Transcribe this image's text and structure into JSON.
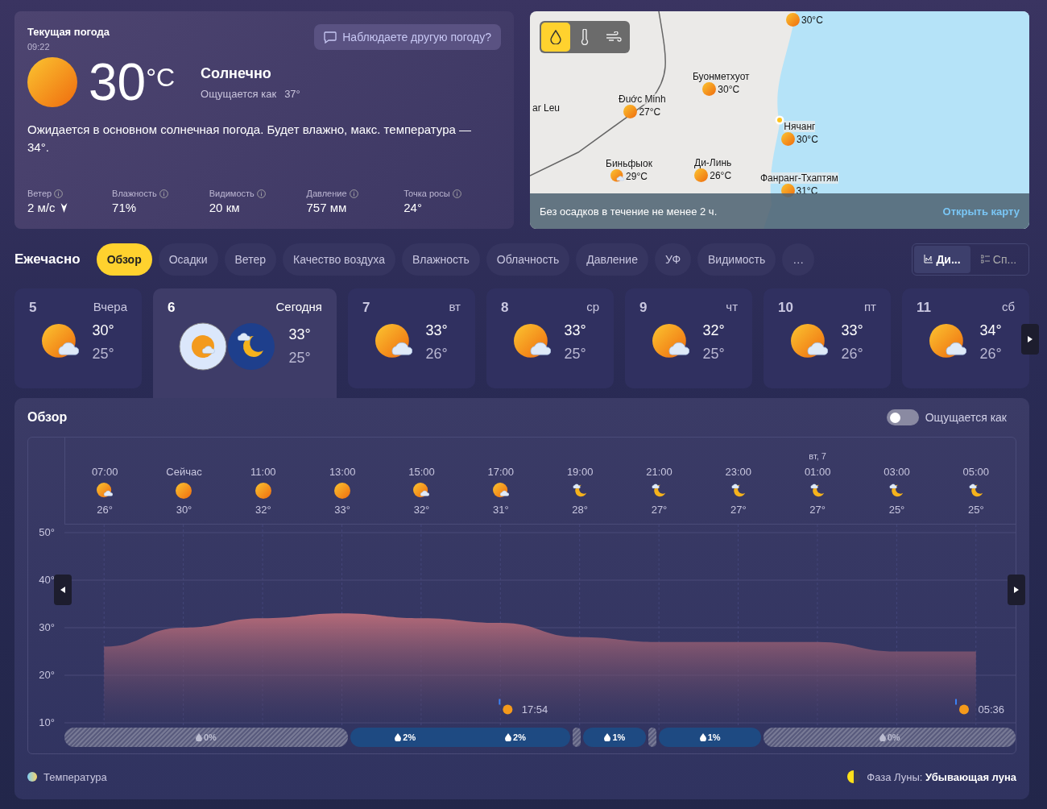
{
  "current": {
    "title": "Текущая погода",
    "time": "09:22",
    "feedback_button": "Наблюдаете другую погоду?",
    "temperature": "30",
    "unit": "°C",
    "condition": "Солнечно",
    "feels_like_label": "Ощущается как",
    "feels_like": "37°",
    "summary": "Ожидается в основном солнечная погода. Будет влажно, макс. температура — 34°.",
    "details": [
      {
        "label": "Ветер",
        "value": "2 м/с",
        "kind": "wind"
      },
      {
        "label": "Влажность",
        "value": "71%",
        "kind": "plain"
      },
      {
        "label": "Видимость",
        "value": "20 км",
        "kind": "plain"
      },
      {
        "label": "Давление",
        "value": "757 мм",
        "kind": "plain"
      },
      {
        "label": "Точка росы",
        "value": "24°",
        "kind": "plain"
      }
    ]
  },
  "map": {
    "layers": [
      {
        "kind": "precipitation",
        "selected": true
      },
      {
        "kind": "temperature",
        "selected": false
      },
      {
        "kind": "wind",
        "selected": false
      }
    ],
    "cities": [
      {
        "temp": "30°C",
        "kind": "sunny"
      },
      {
        "name": "Буонметхуот",
        "temp": "30°C",
        "kind": "sunny"
      },
      {
        "name": "ar Leu",
        "kind": "label"
      },
      {
        "name": "Đuớc Minh",
        "temp": "27°C",
        "kind": "sunny"
      },
      {
        "name": "Нячанг",
        "temp": "30°C",
        "kind": "sunny"
      },
      {
        "name": "Биньфыок",
        "temp": "29°C",
        "kind": "partly-cloudy"
      },
      {
        "name": "Ди-Линь",
        "temp": "26°C",
        "kind": "sunny"
      },
      {
        "name": "Фанранг-Тхаптям",
        "temp": "31°C",
        "kind": "sunny"
      }
    ],
    "status": "Без осадков в течение не менее 2 ч.",
    "open_link": "Открыть карту"
  },
  "hourly": {
    "title": "Ежечасно",
    "tabs": [
      {
        "label": "Обзор",
        "selected": true
      },
      {
        "label": "Осадки",
        "selected": false
      },
      {
        "label": "Ветер",
        "selected": false
      },
      {
        "label": "Качество воздуха",
        "selected": false
      },
      {
        "label": "Влажность",
        "selected": false
      },
      {
        "label": "Облачность",
        "selected": false
      },
      {
        "label": "Давление",
        "selected": false
      },
      {
        "label": "УФ",
        "selected": false
      },
      {
        "label": "Видимость",
        "selected": false
      },
      {
        "label": "…",
        "selected": false
      }
    ],
    "views": [
      {
        "label": "Ди...",
        "kind": "chart",
        "selected": true
      },
      {
        "label": "Сп...",
        "kind": "list",
        "selected": false
      }
    ]
  },
  "days": [
    {
      "day": "5",
      "weekday": "Вчера",
      "kind": "partly-cloudy",
      "high": "30°",
      "low": "25°",
      "selected": false
    },
    {
      "day": "6",
      "weekday": "Сегодня",
      "kind": "day-night",
      "high": "33°",
      "low": "25°",
      "selected": true
    },
    {
      "day": "7",
      "weekday": "вт",
      "kind": "partly-cloudy",
      "high": "33°",
      "low": "26°",
      "selected": false
    },
    {
      "day": "8",
      "weekday": "ср",
      "kind": "partly-cloudy",
      "high": "33°",
      "low": "25°",
      "selected": false
    },
    {
      "day": "9",
      "weekday": "чт",
      "kind": "partly-cloudy",
      "high": "32°",
      "low": "25°",
      "selected": false
    },
    {
      "day": "10",
      "weekday": "пт",
      "kind": "partly-cloudy",
      "high": "33°",
      "low": "26°",
      "selected": false
    },
    {
      "day": "11",
      "weekday": "сб",
      "kind": "partly-cloudy",
      "high": "34°",
      "low": "26°",
      "selected": false
    }
  ],
  "overview": {
    "title": "Обзор",
    "feels_toggle": {
      "label": "Ощущается как",
      "on": false
    },
    "hours": [
      {
        "kind": "partly-cloudy",
        "temp": "26°"
      },
      {
        "kind": "sunny",
        "temp": "30°"
      },
      {
        "kind": "sunny",
        "temp": "32°"
      },
      {
        "kind": "sunny",
        "temp": "33°"
      },
      {
        "kind": "partly-cloudy",
        "temp": "32°"
      },
      {
        "kind": "partly-cloudy",
        "temp": "31°"
      },
      {
        "kind": "night-cloudy",
        "temp": "28°"
      },
      {
        "kind": "night-cloudy",
        "temp": "27°"
      },
      {
        "kind": "night-cloudy",
        "temp": "27°"
      },
      {
        "date": "вт, 7",
        "kind": "night-cloudy",
        "temp": "27°"
      },
      {
        "kind": "night-cloudy",
        "temp": "25°"
      },
      {
        "kind": "night-cloudy",
        "temp": "25°"
      }
    ],
    "chart_data": {
      "type": "area",
      "grid": true,
      "categories": [
        "07:00",
        "Сейчас",
        "11:00",
        "13:00",
        "15:00",
        "17:00",
        "19:00",
        "21:00",
        "23:00",
        "01:00",
        "03:00",
        "05:00"
      ],
      "series": [
        {
          "name": "Температура",
          "values": [
            26,
            30,
            32,
            33,
            32,
            31,
            28,
            27,
            27,
            27,
            25,
            25
          ]
        }
      ],
      "ylim": [
        10,
        50
      ],
      "yticks": [
        {
          "value": 50,
          "label": "50°"
        },
        {
          "value": 40,
          "label": "40°"
        },
        {
          "value": 30,
          "label": "30°"
        },
        {
          "value": 20,
          "label": "20°"
        },
        {
          "value": 10,
          "label": "10°"
        }
      ]
    },
    "sun_events": [
      {
        "kind": "sunset",
        "time": "17:54"
      },
      {
        "kind": "sunrise",
        "time": "05:36"
      }
    ],
    "precipitation": [
      {
        "kind": "dry",
        "labels": [
          "0%"
        ]
      },
      {
        "kind": "rain",
        "labels": [
          "2%",
          "2%"
        ]
      },
      {
        "kind": "dry"
      },
      {
        "kind": "rain",
        "labels": [
          "1%"
        ]
      },
      {
        "kind": "dry"
      },
      {
        "kind": "rain",
        "labels": [
          "1%"
        ]
      },
      {
        "kind": "dry",
        "labels": [
          "0%"
        ]
      }
    ],
    "moon_phase": "Фаза Луны: **Убывающая луна**"
  }
}
